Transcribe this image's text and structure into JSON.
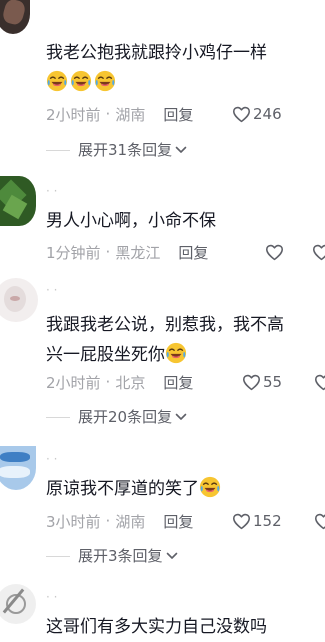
{
  "comments": [
    {
      "text": "我老公抱我就跟拎小鸡仔一样",
      "emoji_count": 3,
      "time": "2小时前",
      "location": "湖南",
      "reply_label": "回复",
      "likes": "246",
      "expand_label": "展开31条回复"
    },
    {
      "text": "男人小心啊，小命不保",
      "time": "1分钟前",
      "location": "黑龙江",
      "reply_label": "回复",
      "likes": ""
    },
    {
      "text_line1": "我跟我老公说，别惹我，我不高",
      "text_line2": "兴一屁股坐死你",
      "time": "2小时前",
      "location": "北京",
      "reply_label": "回复",
      "likes": "55",
      "expand_label": "展开20条回复"
    },
    {
      "text": "原谅我不厚道的笑了",
      "time": "3小时前",
      "location": "湖南",
      "reply_label": "回复",
      "likes": "152",
      "expand_label": "展开3条回复"
    },
    {
      "text": "这哥们有多大实力自己没数吗"
    }
  ],
  "icons": {
    "like": "heart-outline-icon",
    "emoji": "laughing-crying-emoji-icon",
    "expand": "chevron-down-icon"
  },
  "colors": {
    "primary_text": "#161823",
    "secondary_text": "#a2a3a8",
    "action_text": "#5e6068",
    "emoji_yellow": "#f7c531"
  }
}
